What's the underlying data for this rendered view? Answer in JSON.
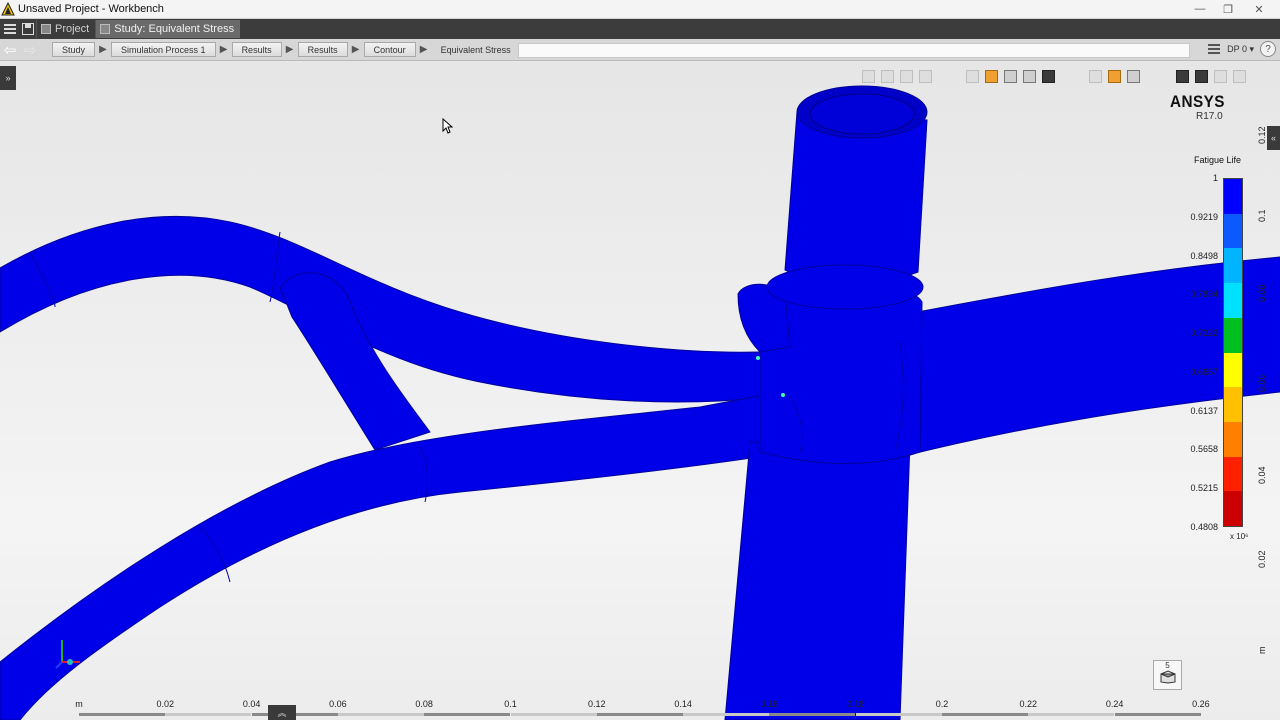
{
  "window": {
    "title": "Unsaved Project - Workbench",
    "minimize": "—",
    "maximize": "❐",
    "close": "✕"
  },
  "tabs": [
    {
      "label": "Project",
      "active": false
    },
    {
      "label": "Study: Equivalent Stress",
      "active": true
    }
  ],
  "nav": {
    "back": "⇦",
    "forward": "⇨"
  },
  "breadcrumb": [
    "Study",
    "Simulation Process 1",
    "Results",
    "Results",
    "Contour",
    "Equivalent Stress"
  ],
  "toolbar": {
    "dp_label": "DP 0 ▾",
    "help": "?"
  },
  "brand": {
    "name": "ANSYS",
    "version": "R17.0"
  },
  "legend": {
    "title": "Fatigue Life",
    "labels": [
      "1",
      "0.9219",
      "0.8498",
      "0.7834",
      "0.7222",
      "0.6657",
      "0.6137",
      "0.5658",
      "0.5215",
      "0.4808"
    ],
    "exponent": "x 10⁶",
    "colors": [
      "#0000ff",
      "#0b5aff",
      "#00b4ff",
      "#00e0ff",
      "#00c020",
      "#ffff00",
      "#ffc000",
      "#ff8000",
      "#ff2000",
      "#cc0000"
    ]
  },
  "right_scale": [
    "0.12",
    "0.1",
    "0.08",
    "0.06",
    "0.04",
    "0.02",
    "m"
  ],
  "ruler": {
    "labels": [
      "m",
      "0.02",
      "0.04",
      "0.06",
      "0.08",
      "0.1",
      "0.12",
      "0.14",
      "0.16",
      "0.18",
      "0.2",
      "0.22",
      "0.24",
      "0.26"
    ]
  },
  "view_button": {
    "number": "5"
  },
  "side_toggle": "»",
  "right_toggle": "«",
  "collapse": "︽",
  "colors": {
    "model": "#0000e8",
    "model_shadow": "#0000a8"
  }
}
